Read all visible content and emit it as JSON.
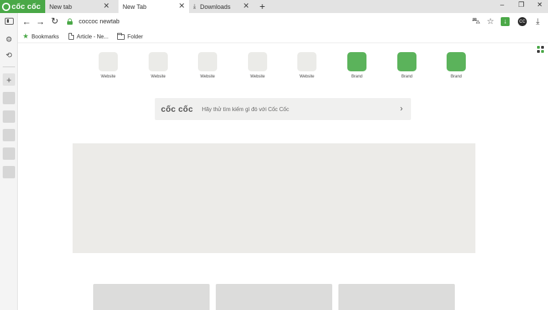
{
  "brand": {
    "name": "cốc cốc",
    "accent_color": "#4aa847"
  },
  "tabs": [
    {
      "label": "New tab",
      "active": false,
      "icon": ""
    },
    {
      "label": "New Tab",
      "active": true,
      "icon": ""
    },
    {
      "label": "Downloads",
      "active": false,
      "icon": "download-icon"
    }
  ],
  "tab_controls": {
    "close_glyph": "✕",
    "new_tab_glyph": "+"
  },
  "window_controls": {
    "minimize": "–",
    "restore": "❐",
    "close": "✕"
  },
  "sidebar": {
    "icons": [
      "sidebar-panel-icon",
      "settings-icon",
      "history-icon"
    ],
    "add_glyph": "+",
    "slot_count": 5
  },
  "toolbar": {
    "back": "←",
    "forward": "→",
    "reload": "↻",
    "address": "coccoc newtab",
    "cart": "🛒",
    "star": "☆",
    "extension": "↓",
    "avatar": "CC",
    "download": "⤓"
  },
  "bookmarks": [
    {
      "label": "Bookmarks",
      "icon": "star-icon"
    },
    {
      "label": "Article - Ne...",
      "icon": "page-icon"
    },
    {
      "label": "Folder",
      "icon": "folder-icon"
    }
  ],
  "speed_dial": [
    {
      "label": "Website",
      "kind": "website"
    },
    {
      "label": "Website",
      "kind": "website"
    },
    {
      "label": "Website",
      "kind": "website"
    },
    {
      "label": "Website",
      "kind": "website"
    },
    {
      "label": "Website",
      "kind": "website"
    },
    {
      "label": "Brand",
      "kind": "brand"
    },
    {
      "label": "Brand",
      "kind": "brand"
    },
    {
      "label": "Brand",
      "kind": "brand"
    }
  ],
  "search": {
    "logo_text": "cốc cốc",
    "placeholder": "Hãy thử tìm kiếm gì đó với Cốc Cốc",
    "go_glyph": "›"
  }
}
